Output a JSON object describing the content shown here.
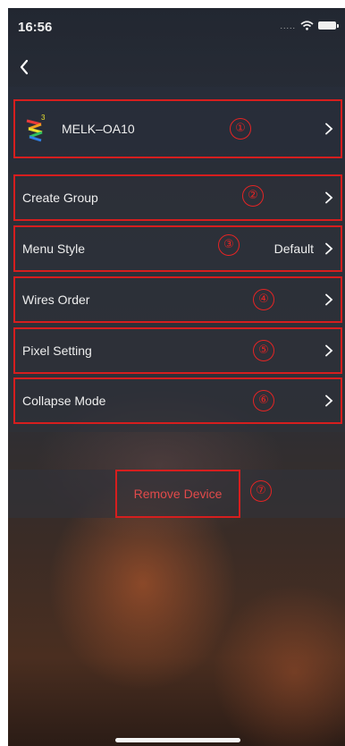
{
  "status_bar": {
    "time": "16:56",
    "signal_text": "....."
  },
  "device": {
    "name": "MELK–OA10"
  },
  "menu": {
    "create_group": "Create Group",
    "menu_style": "Menu Style",
    "menu_style_value": "Default",
    "wires_order": "Wires Order",
    "pixel_setting": "Pixel Setting",
    "collapse_mode": "Collapse Mode"
  },
  "remove_device_label": "Remove Device",
  "annotations": [
    "①",
    "②",
    "③",
    "④",
    "⑤",
    "⑥",
    "⑦"
  ],
  "colors": {
    "annotation_red": "#d61e1e",
    "remove_text": "#e14a4a",
    "text": "#eeeeee"
  },
  "icons": [
    "back-chevron-icon",
    "device-logo-icon",
    "chevron-right-icon",
    "wifi-icon",
    "battery-icon"
  ]
}
